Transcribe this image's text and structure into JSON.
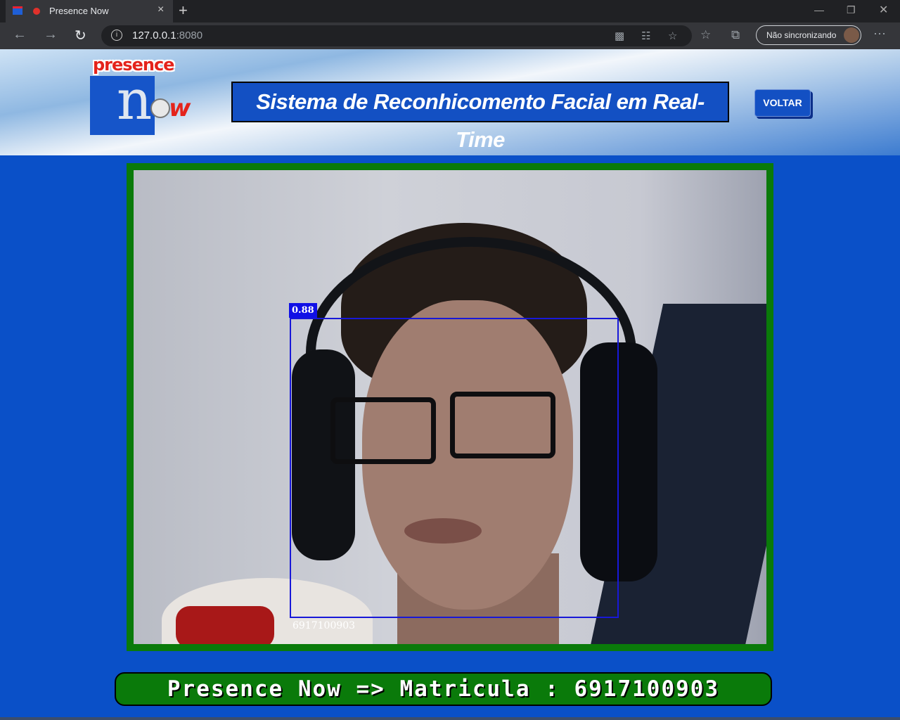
{
  "browser": {
    "tab_title": "Presence Now",
    "new_tab_symbol": "+",
    "close_symbol": "×",
    "url_host": "127.0.0.1",
    "url_port": ":8080",
    "sync_label": "Não sincronizando",
    "icons": [
      "back-icon",
      "forward-icon",
      "refresh-icon",
      "info-icon",
      "camera-icon",
      "translate-icon",
      "star-icon",
      "favorites-icon",
      "collections-icon",
      "more-icon"
    ]
  },
  "header": {
    "logo_top": "presence",
    "logo_n": "n",
    "logo_w": "w",
    "title": "Sistema de Reconhicomento Facial em Real-Time",
    "back_button": "VOLTAR"
  },
  "camera": {
    "confidence": "0.88",
    "matricula": "6917100903"
  },
  "result": {
    "text": "Presence Now => Matricula : 6917100903"
  },
  "colors": {
    "page_bg": "#0a50c8",
    "frame_green": "#0a7a0a",
    "bbox_blue": "#1818d8",
    "brand_red": "#e4231b"
  }
}
